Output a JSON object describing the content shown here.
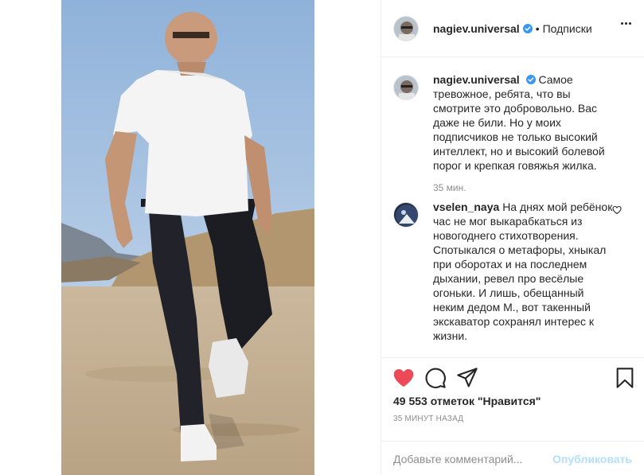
{
  "header": {
    "username": "nagiev.universal",
    "separator": "•",
    "follow_state": "Подписки"
  },
  "comments": [
    {
      "username": "nagiev.universal",
      "text": "Самое тревожное, ребята, что вы смотрите это добровольно. Вас даже не били. Но у моих подписчиков не только высокий интеллект, но и высокий болевой порог и крепкая говяжья жилка.",
      "time": "35 мин."
    },
    {
      "username": "vselen_naya",
      "text": "На днях мой ребёнок час не мог выкарабкаться из новогоднего стихотворения. Спотыкался о метафоры, хныкал при оборотах и на последнем дыхании, ревел про весёлые огоньки. И лишь, обещанный неким дедом М., вот такенный экскаватор сохранял интерес к жизни."
    }
  ],
  "actions": {
    "like_icon": "heart-filled-icon",
    "comment_icon": "comment-bubble-icon",
    "share_icon": "paper-plane-icon",
    "save_icon": "bookmark-icon",
    "like_color": "#ed4956"
  },
  "likes_text": "49 553 отметок \"Нравится\"",
  "timestamp": "35 минут назад",
  "add_comment": {
    "placeholder": "Добавьте комментарий...",
    "publish_label": "Опубликовать"
  },
  "colors": {
    "text": "#262626",
    "muted": "#8e8e8e",
    "border": "#efefef",
    "publish_disabled": "#b2dffc",
    "verified": "#3897f0"
  }
}
